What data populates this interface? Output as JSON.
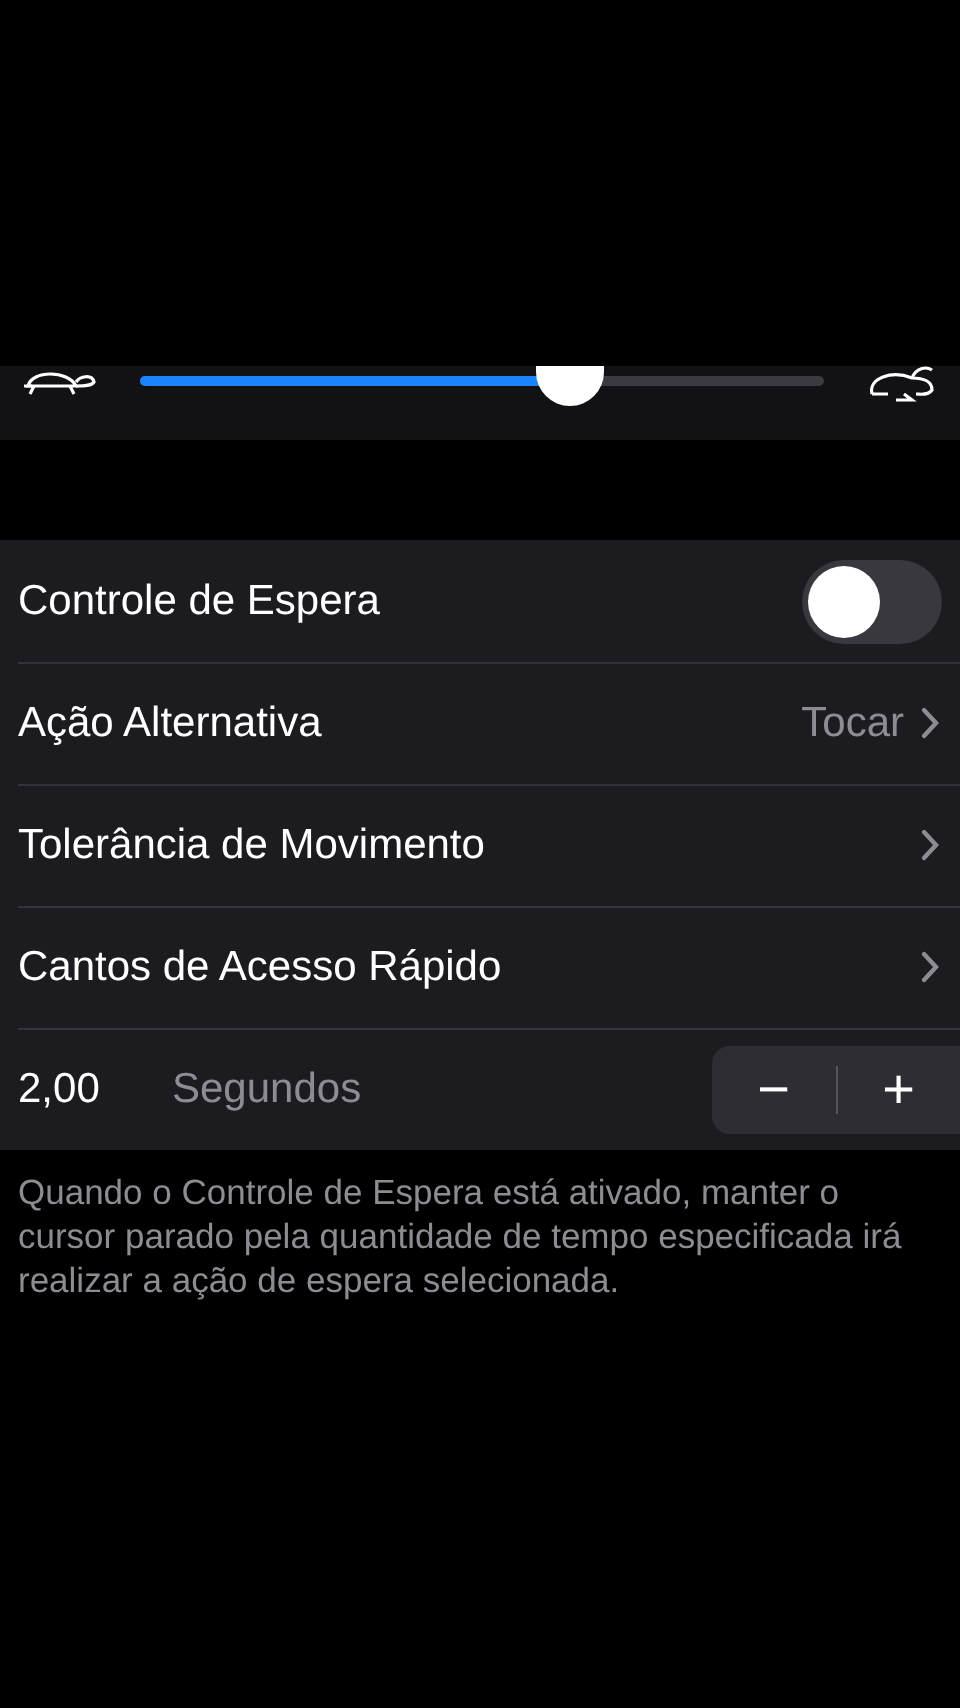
{
  "speed_slider": {
    "level": 0.63
  },
  "rows": [
    {
      "kind": "toggle",
      "label": "Controle de Espera",
      "on": false
    },
    {
      "kind": "link",
      "label": "Ação Alternativa",
      "value": "Tocar"
    },
    {
      "kind": "link",
      "label": "Tolerância de Movimento"
    },
    {
      "kind": "link",
      "label": "Cantos de Acesso Rápido"
    },
    {
      "kind": "stepper",
      "value": "2,00",
      "unit": "Segundos",
      "decrement": "−",
      "increment": "+"
    }
  ],
  "footer": "Quando o Controle de Espera está ativado, manter o cursor parado pela quantidade de tempo especificada irá realizar a ação de espera selecionada."
}
